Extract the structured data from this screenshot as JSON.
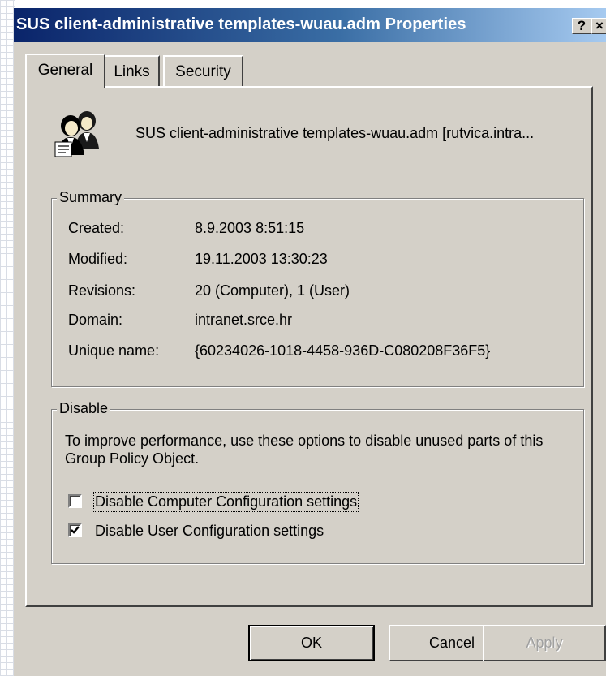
{
  "window": {
    "title": "SUS client-administrative templates-wuau.adm Properties",
    "help_button": "?",
    "close_button": "×"
  },
  "tabs": [
    {
      "label": "General",
      "selected": true
    },
    {
      "label": "Links",
      "selected": false
    },
    {
      "label": "Security",
      "selected": false
    }
  ],
  "gpo": {
    "icon": "group-policy-users-icon",
    "name": "SUS client-administrative templates-wuau.adm [rutvica.intra..."
  },
  "summary": {
    "legend": "Summary",
    "rows": [
      {
        "label": "Created:",
        "value": "8.9.2003 8:51:15"
      },
      {
        "label": "Modified:",
        "value": "19.11.2003 13:30:23"
      },
      {
        "label": "Revisions:",
        "value": "20 (Computer), 1 (User)"
      },
      {
        "label": "Domain:",
        "value": "intranet.srce.hr"
      },
      {
        "label": "Unique name:",
        "value": "{60234026-1018-4458-936D-C080208F36F5}"
      }
    ]
  },
  "disable": {
    "legend": "Disable",
    "description": "To improve performance, use these options to disable unused parts of this Group Policy Object.",
    "options": [
      {
        "label": "Disable Computer Configuration settings",
        "checked": false
      },
      {
        "label": "Disable User Configuration settings",
        "checked": true
      }
    ]
  },
  "buttons": {
    "ok": "OK",
    "cancel": "Cancel",
    "apply": "Apply"
  },
  "colors": {
    "titlebar_start": "#0a246a",
    "titlebar_end": "#a6caf0",
    "face": "#d4d0c8"
  }
}
